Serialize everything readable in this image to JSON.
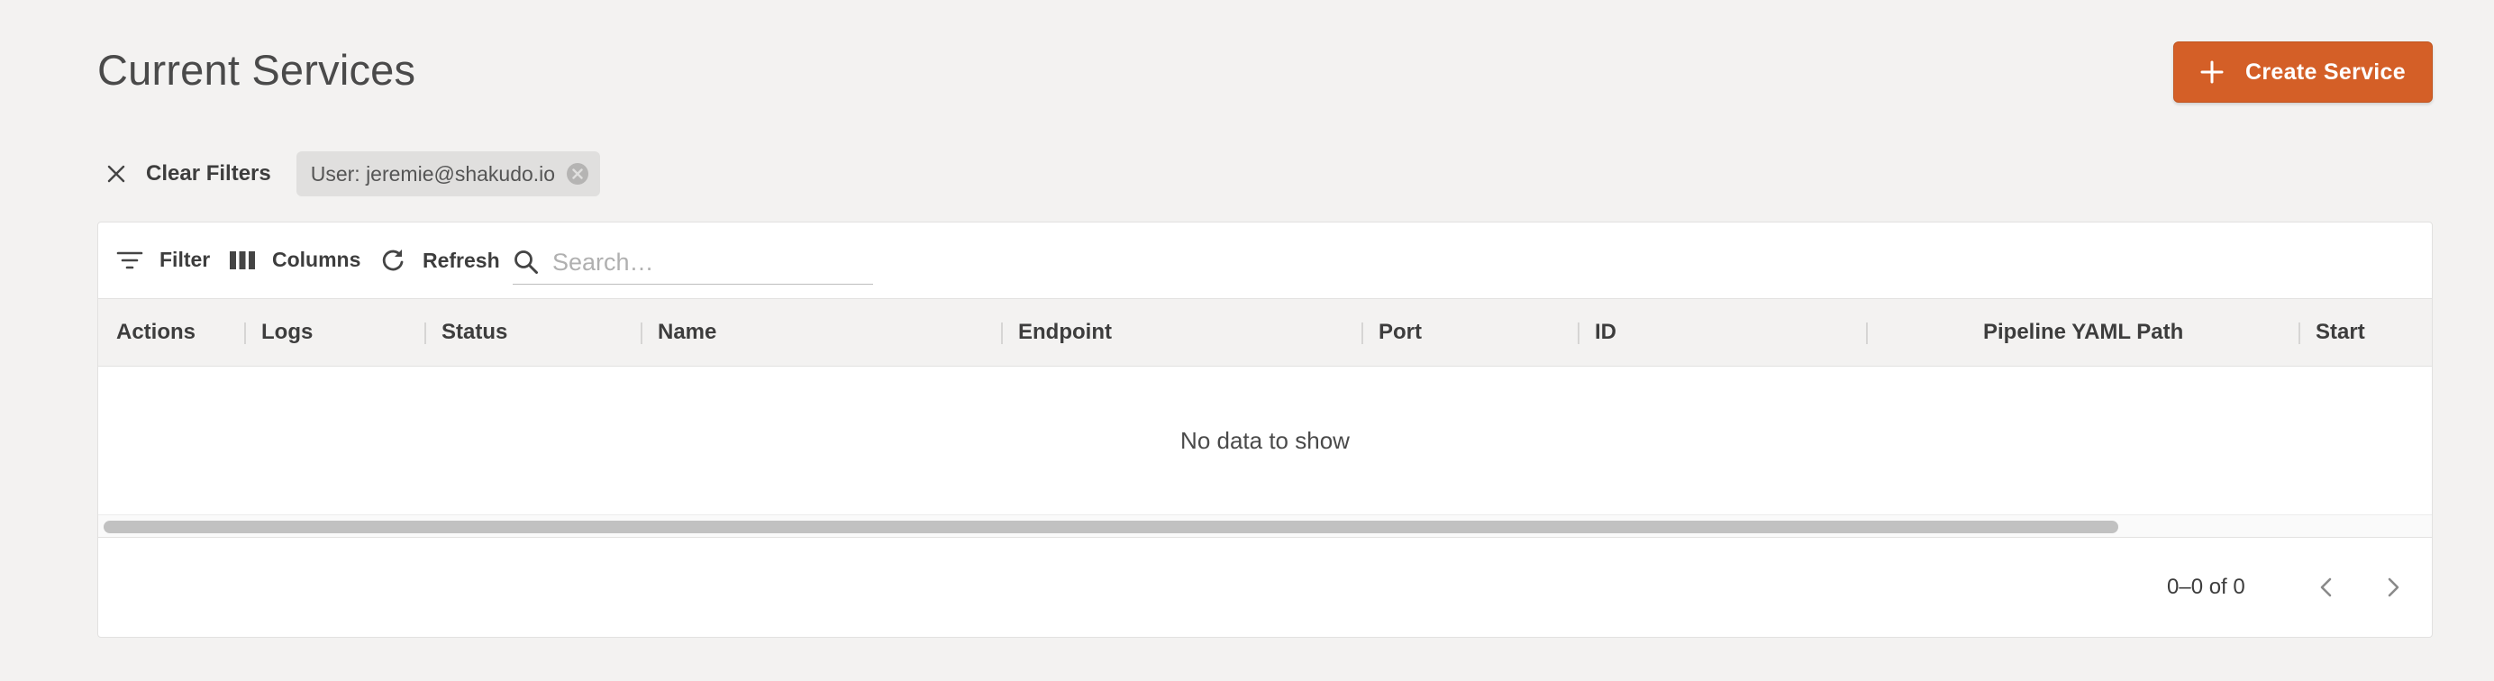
{
  "page": {
    "title": "Current Services"
  },
  "actions": {
    "create_label": "Create Service",
    "accent_color": "#d45f27"
  },
  "filters": {
    "clear_label": "Clear Filters",
    "chips": [
      {
        "label": "User: jeremie@shakudo.io"
      }
    ]
  },
  "toolbar": {
    "filter_label": "Filter",
    "columns_label": "Columns",
    "refresh_label": "Refresh",
    "search_placeholder": "Search…",
    "search_value": ""
  },
  "table": {
    "columns": [
      "Actions",
      "Logs",
      "Status",
      "Name",
      "Endpoint",
      "Port",
      "ID",
      "Pipeline YAML Path",
      "Start"
    ],
    "rows": [],
    "empty_message": "No data to show"
  },
  "pagination": {
    "label": "0–0 of 0"
  },
  "icons": [
    "plus-icon",
    "close-icon",
    "cancel-circle-icon",
    "filter-icon",
    "columns-icon",
    "refresh-icon",
    "search-icon",
    "chevron-left-icon",
    "chevron-right-icon"
  ]
}
